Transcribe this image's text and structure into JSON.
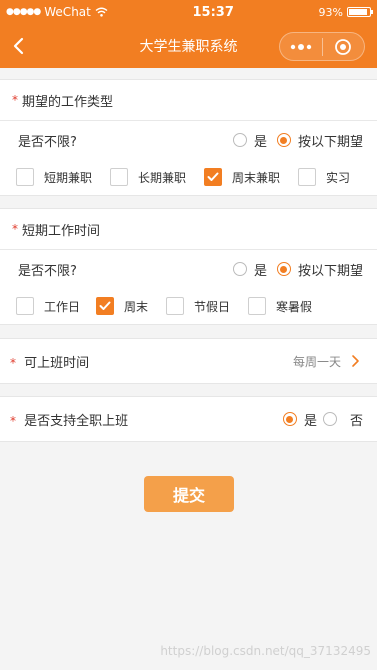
{
  "status_bar": {
    "carrier": "WeChat",
    "time": "15:37",
    "battery": "93%",
    "battery_level": 0.93
  },
  "nav": {
    "title": "大学生兼职系统"
  },
  "section_job_type": {
    "title": "期望的工作类型",
    "question": "是否不限?",
    "options": [
      {
        "label": "是",
        "selected": false
      },
      {
        "label": "按以下期望",
        "selected": true
      }
    ],
    "checkboxes": [
      {
        "label": "短期兼职",
        "checked": false
      },
      {
        "label": "长期兼职",
        "checked": false
      },
      {
        "label": "周末兼职",
        "checked": true
      },
      {
        "label": "实习",
        "checked": false
      }
    ]
  },
  "section_short_time": {
    "title": "短期工作时间",
    "question": "是否不限?",
    "options": [
      {
        "label": "是",
        "selected": false
      },
      {
        "label": "按以下期望",
        "selected": true
      }
    ],
    "checkboxes": [
      {
        "label": "工作日",
        "checked": false
      },
      {
        "label": "周末",
        "checked": true
      },
      {
        "label": "节假日",
        "checked": false
      },
      {
        "label": "寒暑假",
        "checked": false
      }
    ]
  },
  "work_time": {
    "label": "可上班时间",
    "value": "每周一天"
  },
  "fulltime": {
    "label": "是否支持全职上班",
    "options": [
      {
        "label": "是",
        "selected": true
      },
      {
        "label": "否",
        "selected": false
      }
    ]
  },
  "submit": {
    "label": "提交"
  },
  "watermark": "https://blog.csdn.net/qq_37132495",
  "colors": {
    "accent": "#f27e22",
    "submit": "#f4a04a",
    "required": "#e03c2d"
  }
}
